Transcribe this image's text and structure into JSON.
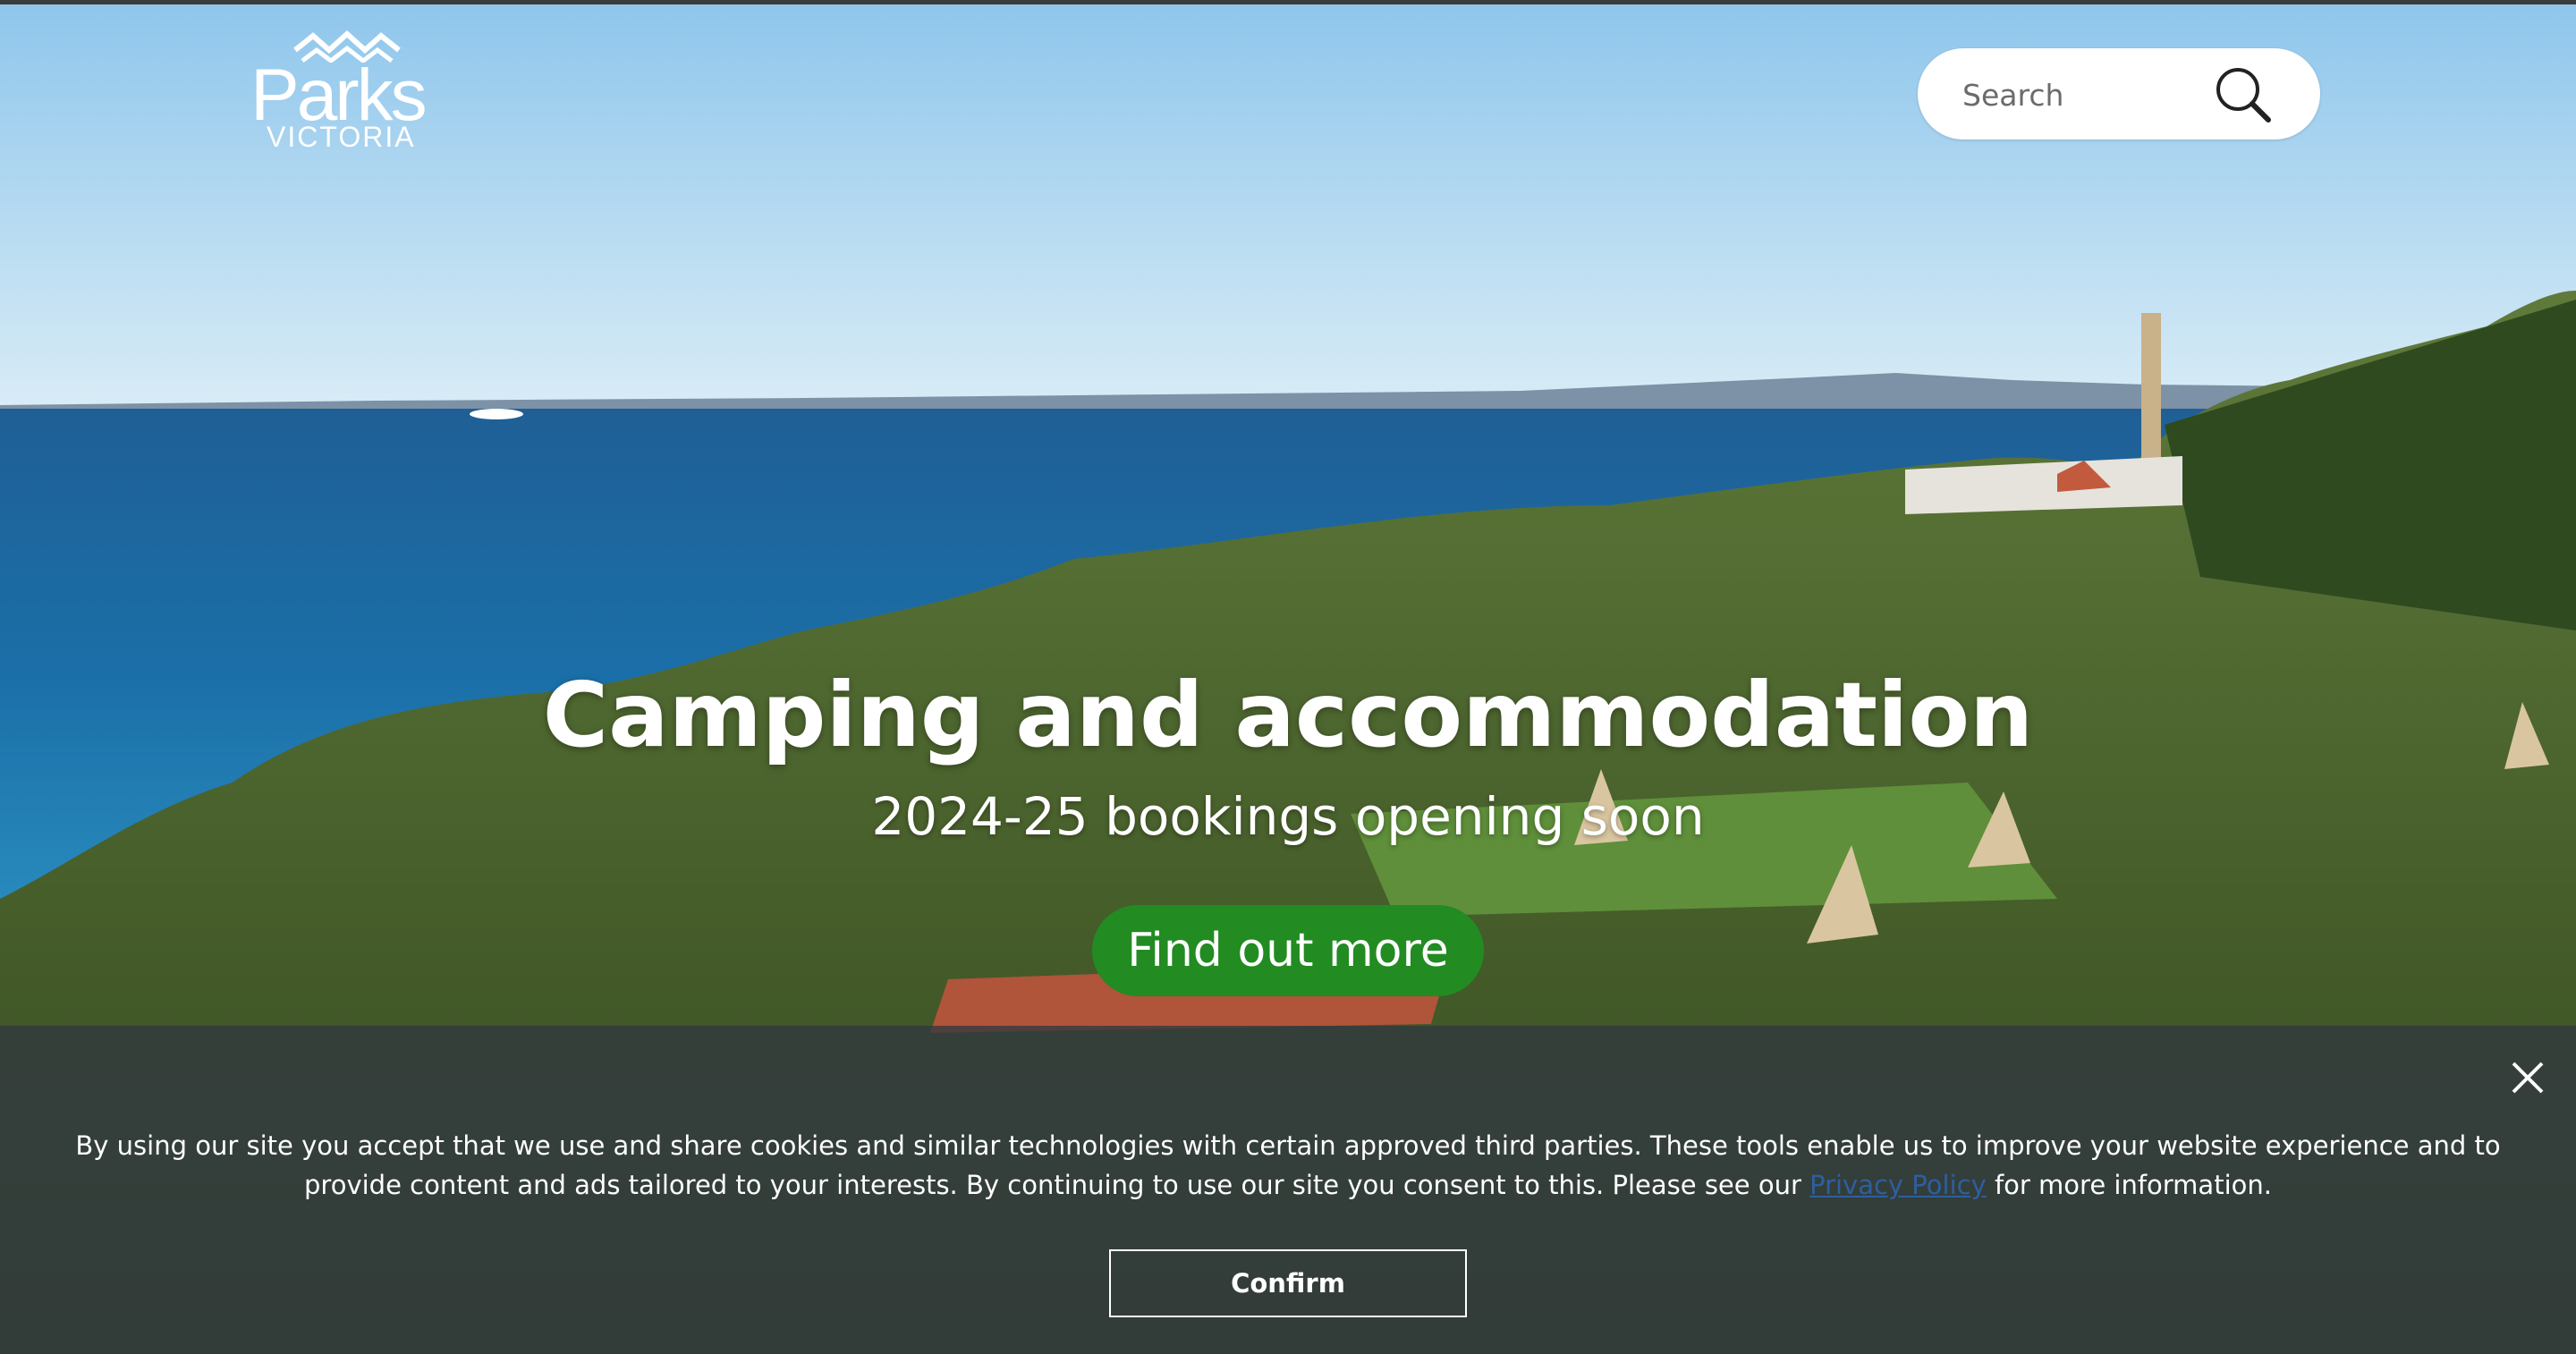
{
  "header": {
    "logo_word": "Parks",
    "logo_sub": "VICTORIA"
  },
  "search": {
    "placeholder": "Search",
    "icon": "search-icon"
  },
  "hero": {
    "title": "Camping and accommodation",
    "subtitle": "2024-25 bookings opening soon",
    "cta_label": "Find out more",
    "cta_color": "#228b22"
  },
  "cookie_banner": {
    "text_before": "By using our site you accept that we use and share cookies and similar technologies with certain approved third parties. These tools enable us to improve your website experience and to provide content and ads tailored to your interests. By continuing to use our site you consent to this. Please see our ",
    "link_label": "Privacy Policy",
    "text_after": " for more information.",
    "confirm_label": "Confirm",
    "close_icon": "close-icon"
  }
}
